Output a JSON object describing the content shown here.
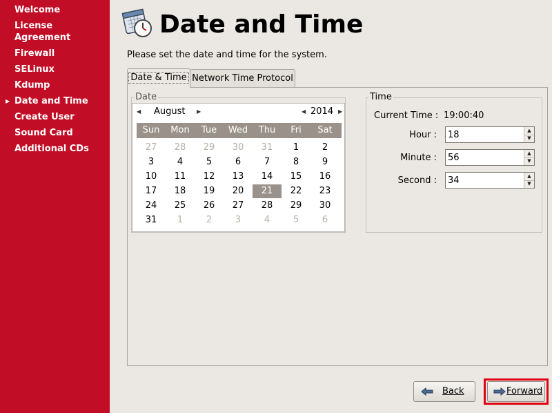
{
  "sidebar": {
    "items": [
      {
        "label": "Welcome"
      },
      {
        "label": "License"
      },
      {
        "label": "Agreement"
      },
      {
        "label": "Firewall"
      },
      {
        "label": "SELinux"
      },
      {
        "label": "Kdump"
      },
      {
        "label": "Date and Time",
        "current": true
      },
      {
        "label": "Create User"
      },
      {
        "label": "Sound Card"
      },
      {
        "label": "Additional CDs"
      }
    ]
  },
  "header": {
    "title": "Date and Time",
    "icon": "calendar-clock-icon",
    "instruction": "Please set the date and time for the system."
  },
  "tabs": {
    "date_time": "Date & Time",
    "ntp": "Network Time Protocol"
  },
  "date": {
    "frame_label": "Date",
    "month": "August",
    "year": "2014",
    "weekdays": [
      "Sun",
      "Mon",
      "Tue",
      "Wed",
      "Thu",
      "Fri",
      "Sat"
    ],
    "weeks": [
      [
        "27",
        "28",
        "29",
        "30",
        "31",
        "1",
        "2"
      ],
      [
        "3",
        "4",
        "5",
        "6",
        "7",
        "8",
        "9"
      ],
      [
        "10",
        "11",
        "12",
        "13",
        "14",
        "15",
        "16"
      ],
      [
        "17",
        "18",
        "19",
        "20",
        "21",
        "22",
        "23"
      ],
      [
        "24",
        "25",
        "26",
        "27",
        "28",
        "29",
        "30"
      ],
      [
        "31",
        "1",
        "2",
        "3",
        "4",
        "5",
        "6"
      ]
    ],
    "selected": "21"
  },
  "time": {
    "frame_label": "Time",
    "current_label": "Current Time :",
    "current_value": "19:00:40",
    "hour_label": "Hour :",
    "hour_value": "18",
    "minute_label": "Minute :",
    "minute_value": "56",
    "second_label": "Second :",
    "second_value": "34"
  },
  "buttons": {
    "back": "Back",
    "forward": "Forward"
  },
  "colors": {
    "sidebar": "#c10d25",
    "highlight": "#e00010",
    "calendar_header": "#9a928a"
  }
}
